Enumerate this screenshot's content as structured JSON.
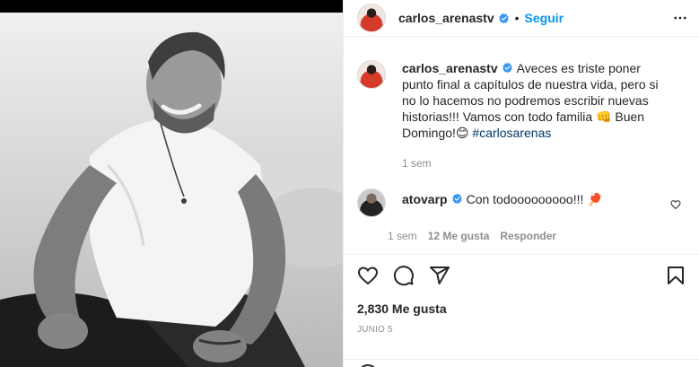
{
  "post": {
    "username": "carlos_arenastv",
    "separator": "•",
    "follow_label": "Seguir"
  },
  "caption": {
    "username": "carlos_arenastv",
    "text_part1": "Aveces es triste poner punto final a capítulos de nuestra vida, pero si no lo hacemos no podremos escribir nuevas historias!!! Vamos con todo familia ",
    "emoji1": "👊",
    "text_part2": " Buen Domingo!",
    "emoji2": "😊",
    "hashtag": "#carlosarenas",
    "time": "1 sem"
  },
  "comment": {
    "username": "atovarp",
    "text": "Con todooooooooo!!! ",
    "emoji": "🏓",
    "time": "1 sem",
    "likes": "12 Me gusta",
    "reply": "Responder"
  },
  "footer": {
    "likes": "2,830 Me gusta",
    "date": "JUNIO 5"
  },
  "icons": {
    "more": "more-options-icon",
    "like": "heart-icon",
    "comment": "comment-icon",
    "share": "share-icon",
    "save": "bookmark-icon",
    "verified": "verified-badge-icon"
  },
  "colors": {
    "accent": "#0095f6",
    "text": "#262626",
    "muted": "#8e8e8e",
    "hashtag": "#00376b",
    "verified": "#3897f0"
  }
}
